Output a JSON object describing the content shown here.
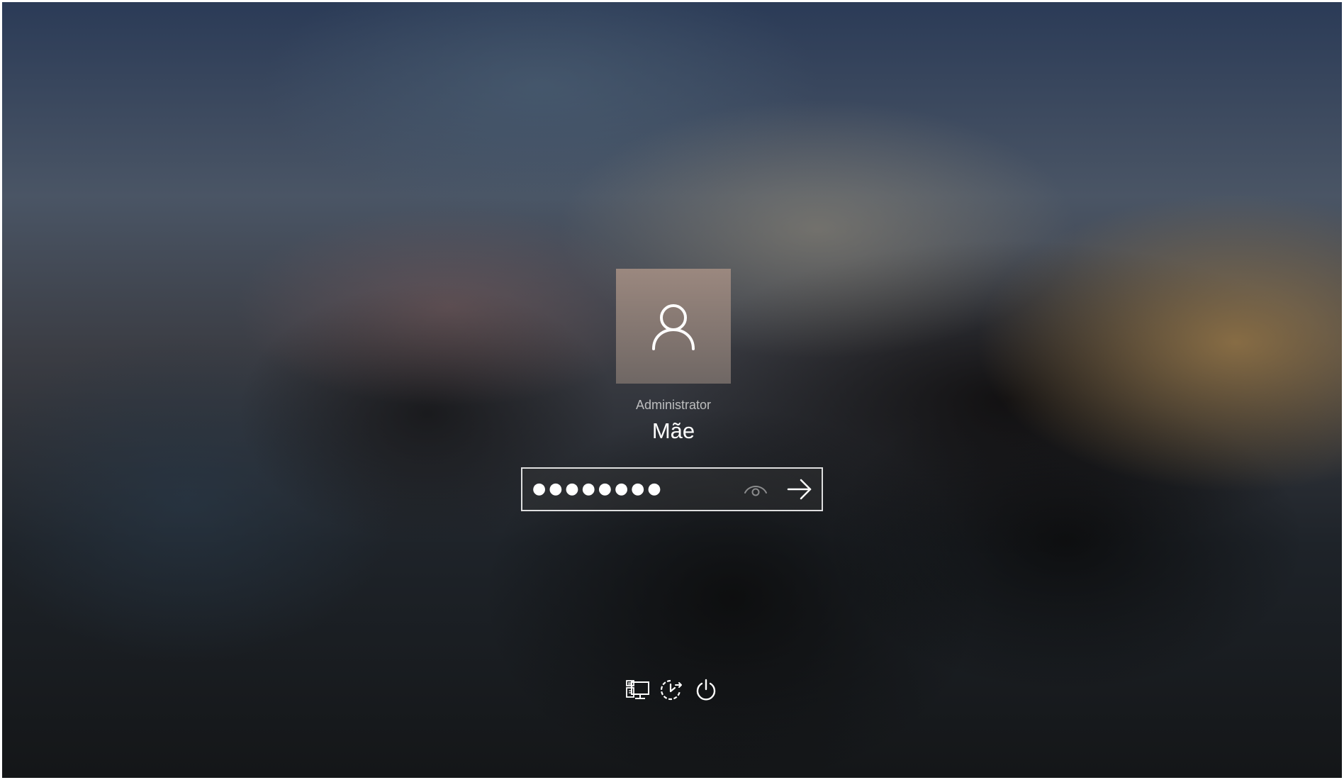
{
  "lock_screen": {
    "user": {
      "role": "Administrator",
      "name": "Mãe"
    },
    "password": {
      "masked_value": "●●●●●●●●",
      "reveal_icon": "eye-icon",
      "submit_icon": "arrow-right-icon"
    },
    "bottom_controls": [
      {
        "icon": "network-icon"
      },
      {
        "icon": "accessibility-icon"
      },
      {
        "icon": "power-icon"
      }
    ]
  },
  "colors": {
    "text_primary": "#ffffff",
    "text_secondary": "#dcdcdc",
    "input_border": "#ffffff",
    "avatar_tile": "#8a7b75"
  }
}
